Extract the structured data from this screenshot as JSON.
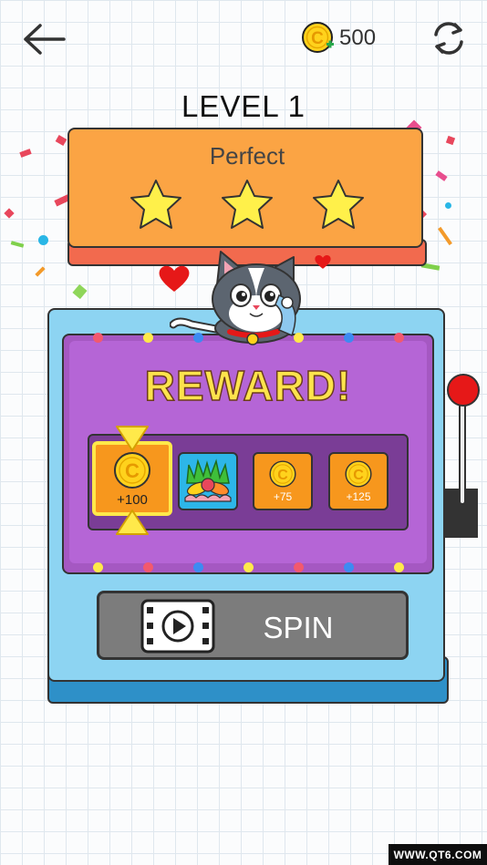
{
  "header": {
    "coin_symbol": "C",
    "coin_count": "500",
    "coin_plus_color": "#27a84b"
  },
  "level": {
    "title": "LEVEL 1"
  },
  "result": {
    "label": "Perfect",
    "stars": 3
  },
  "reward": {
    "title": "REWARD!",
    "slots": [
      {
        "type": "coin",
        "amount": "+100",
        "selected": true
      },
      {
        "type": "vegetables",
        "amount": "",
        "selected": false
      },
      {
        "type": "coin",
        "amount": "+75",
        "selected": false
      },
      {
        "type": "coin",
        "amount": "+125",
        "selected": false
      }
    ]
  },
  "spin": {
    "label": "SPIN",
    "icon": "video-play-icon"
  },
  "watermark": {
    "text": "WWW.QT6.COM"
  },
  "colors": {
    "panel_orange": "#fba444",
    "star_yellow": "#fff04a",
    "machine_blue": "#8dd4f2",
    "screen_purple": "#b565d6",
    "lever_red": "#e61818"
  }
}
